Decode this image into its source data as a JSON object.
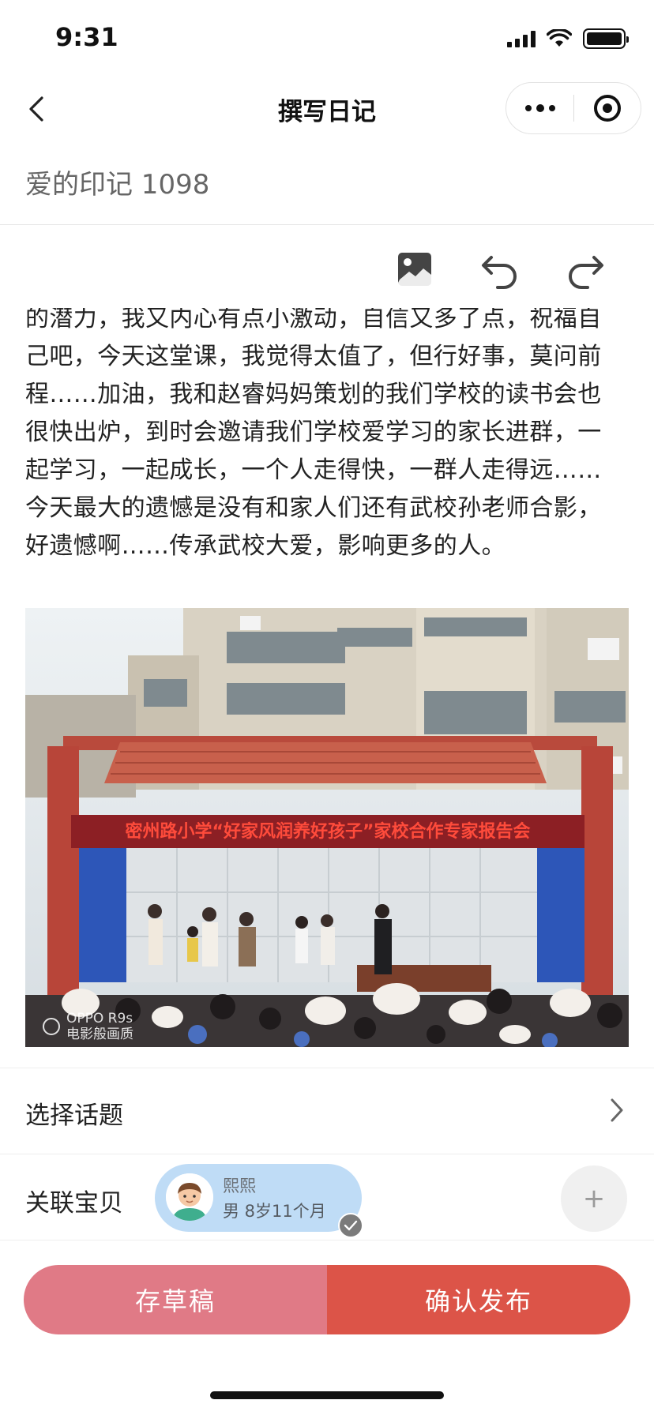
{
  "status_bar": {
    "time": "9:31"
  },
  "nav": {
    "title": "撰写日记",
    "back_icon": "chevron-left-icon",
    "more_icon": "more-dots-icon",
    "close_icon": "target-icon"
  },
  "diary": {
    "title_value": "爱的印记 1098",
    "toolbar": [
      "image-icon",
      "undo-icon",
      "redo-icon"
    ],
    "content": "的潜力，我又内心有点小激动，自信又多了点，祝福自己吧，今天这堂课，我觉得太值了，但行好事，莫问前程……加油，我和赵睿妈妈策划的我们学校的读书会也很快出炉，到时会邀请我们学校爱学习的家长进群，一起学习，一起成长，一个人走得快，一群人走得远……今天最大的遗憾是没有和家人们还有武校孙老师合影，好遗憾啊……传承武校大爱，影响更多的人。",
    "photo": {
      "banner_text": "密州路小学“好家风润养好孩子”家校合作专家报告会",
      "watermark_line1": "OPPO R9s",
      "watermark_line2": "电影般画质"
    }
  },
  "topic": {
    "label": "选择话题"
  },
  "baby": {
    "label": "关联宝贝",
    "name": "熙熙",
    "meta": "男  8岁11个月",
    "add_label": "+"
  },
  "actions": {
    "draft_label": "存草稿",
    "publish_label": "确认发布"
  },
  "colors": {
    "draft": "#e07a86",
    "publish": "#dc5448",
    "chip": "#bfdcf6"
  }
}
